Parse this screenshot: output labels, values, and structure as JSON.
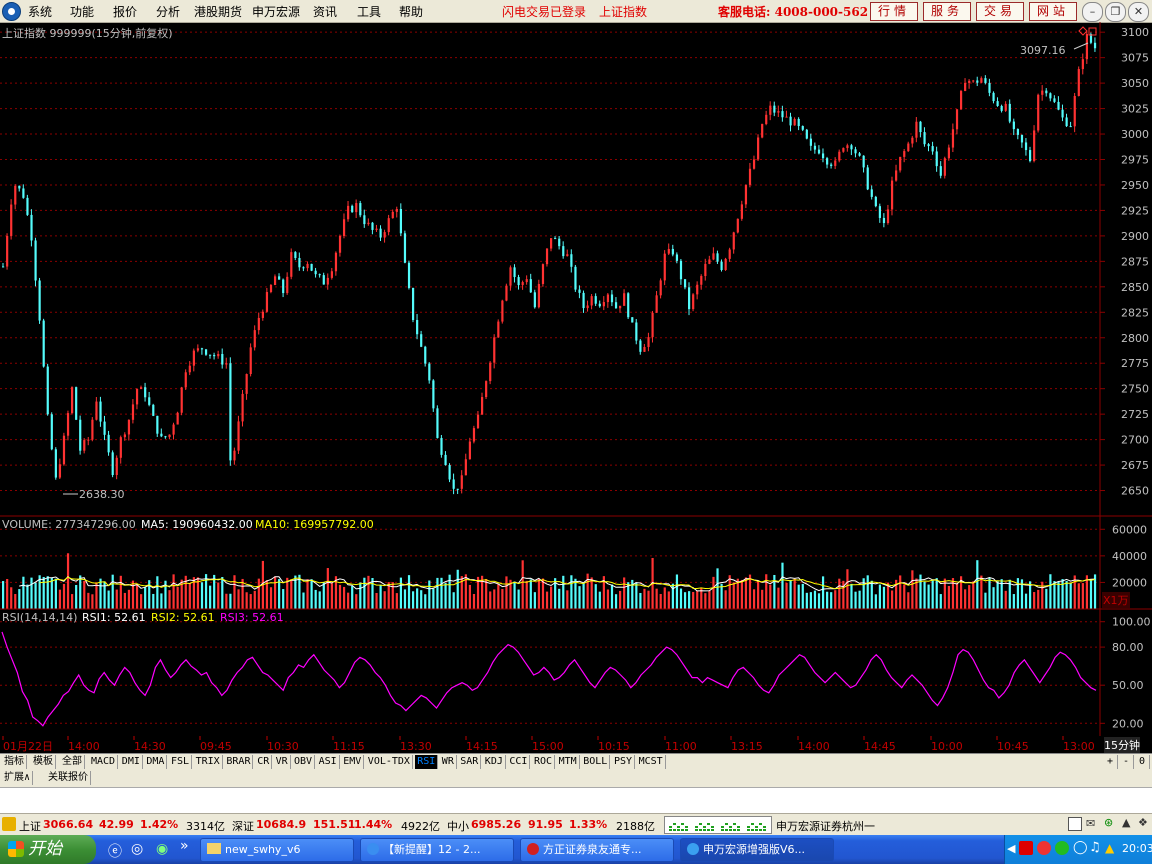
{
  "menu": {
    "items": [
      "系统",
      "功能",
      "报价",
      "分析",
      "港股期货",
      "申万宏源",
      "资讯",
      "工具",
      "帮助"
    ],
    "flash_login": "闪电交易已登录",
    "index_name": "上证指数",
    "hotline": "客服电话: 4008-000-562",
    "buttons": [
      "行情",
      "服务",
      "交易",
      "网站"
    ]
  },
  "chart_data": [
    {
      "type": "candlestick",
      "title": "上证指数 999999(15分钟,前复权)",
      "ylim": [
        2625,
        3110
      ],
      "yticks": [
        "3100",
        "3075",
        "3050",
        "3025",
        "3000",
        "2975",
        "2950",
        "2925",
        "2900",
        "2875",
        "2850",
        "2825",
        "2800",
        "2775",
        "2750",
        "2725",
        "2700",
        "2675",
        "2650"
      ],
      "annotations": [
        {
          "label": "3097.16"
        },
        {
          "label": "2638.30"
        }
      ],
      "close_path": [
        [
          0,
          2870
        ],
        [
          2,
          2935
        ],
        [
          3,
          2950
        ],
        [
          5,
          2940
        ],
        [
          7,
          2900
        ],
        [
          9,
          2820
        ],
        [
          11,
          2720
        ],
        [
          13,
          2660
        ],
        [
          15,
          2700
        ],
        [
          17,
          2750
        ],
        [
          19,
          2690
        ],
        [
          21,
          2700
        ],
        [
          23,
          2740
        ],
        [
          25,
          2700
        ],
        [
          27,
          2670
        ],
        [
          29,
          2700
        ],
        [
          31,
          2720
        ],
        [
          33,
          2750
        ],
        [
          35,
          2745
        ],
        [
          37,
          2720
        ],
        [
          39,
          2700
        ],
        [
          41,
          2705
        ],
        [
          43,
          2730
        ],
        [
          45,
          2770
        ],
        [
          47,
          2785
        ],
        [
          49,
          2790
        ],
        [
          51,
          2785
        ],
        [
          53,
          2780
        ],
        [
          55,
          2775
        ],
        [
          56,
          2680
        ],
        [
          57,
          2690
        ],
        [
          59,
          2740
        ],
        [
          61,
          2790
        ],
        [
          63,
          2820
        ],
        [
          65,
          2840
        ],
        [
          67,
          2860
        ],
        [
          69,
          2845
        ],
        [
          71,
          2880
        ],
        [
          73,
          2870
        ],
        [
          75,
          2875
        ],
        [
          77,
          2860
        ],
        [
          79,
          2855
        ],
        [
          81,
          2870
        ],
        [
          83,
          2900
        ],
        [
          85,
          2925
        ],
        [
          87,
          2930
        ],
        [
          89,
          2915
        ],
        [
          91,
          2905
        ],
        [
          93,
          2900
        ],
        [
          95,
          2915
        ],
        [
          97,
          2930
        ],
        [
          99,
          2870
        ],
        [
          101,
          2820
        ],
        [
          103,
          2790
        ],
        [
          105,
          2760
        ],
        [
          107,
          2700
        ],
        [
          109,
          2680
        ],
        [
          111,
          2650
        ],
        [
          113,
          2660
        ],
        [
          115,
          2700
        ],
        [
          117,
          2720
        ],
        [
          119,
          2760
        ],
        [
          121,
          2800
        ],
        [
          123,
          2840
        ],
        [
          125,
          2870
        ],
        [
          127,
          2850
        ],
        [
          129,
          2860
        ],
        [
          131,
          2830
        ],
        [
          133,
          2870
        ],
        [
          135,
          2900
        ],
        [
          137,
          2890
        ],
        [
          139,
          2880
        ],
        [
          141,
          2850
        ],
        [
          143,
          2830
        ],
        [
          145,
          2840
        ],
        [
          147,
          2835
        ],
        [
          149,
          2845
        ],
        [
          151,
          2830
        ],
        [
          153,
          2840
        ],
        [
          155,
          2810
        ],
        [
          157,
          2790
        ],
        [
          159,
          2800
        ],
        [
          161,
          2840
        ],
        [
          163,
          2880
        ],
        [
          165,
          2885
        ],
        [
          167,
          2860
        ],
        [
          169,
          2830
        ],
        [
          171,
          2850
        ],
        [
          173,
          2870
        ],
        [
          175,
          2880
        ],
        [
          177,
          2870
        ],
        [
          179,
          2890
        ],
        [
          181,
          2920
        ],
        [
          183,
          2950
        ],
        [
          185,
          2975
        ],
        [
          187,
          3010
        ],
        [
          189,
          3025
        ],
        [
          191,
          3020
        ],
        [
          193,
          3015
        ],
        [
          195,
          3010
        ],
        [
          197,
          3000
        ],
        [
          199,
          2985
        ],
        [
          201,
          2985
        ],
        [
          203,
          2975
        ],
        [
          205,
          2970
        ],
        [
          207,
          2990
        ],
        [
          209,
          2990
        ],
        [
          211,
          2975
        ],
        [
          213,
          2950
        ],
        [
          215,
          2925
        ],
        [
          217,
          2910
        ],
        [
          219,
          2950
        ],
        [
          221,
          2975
        ],
        [
          223,
          2990
        ],
        [
          225,
          3010
        ],
        [
          227,
          2990
        ],
        [
          229,
          2985
        ],
        [
          231,
          2960
        ],
        [
          233,
          2990
        ],
        [
          235,
          3020
        ],
        [
          237,
          3055
        ],
        [
          239,
          3050
        ],
        [
          241,
          3055
        ],
        [
          243,
          3040
        ],
        [
          245,
          3030
        ],
        [
          247,
          3025
        ],
        [
          249,
          3000
        ],
        [
          251,
          2990
        ],
        [
          253,
          2975
        ],
        [
          255,
          3040
        ],
        [
          257,
          3045
        ],
        [
          259,
          3030
        ],
        [
          261,
          3015
        ],
        [
          263,
          3010
        ],
        [
          265,
          3060
        ],
        [
          267,
          3095
        ],
        [
          269,
          3085
        ]
      ]
    },
    {
      "type": "bar",
      "title": "VOLUME: 277347296.00",
      "series": [
        {
          "name": "MA5: 190960432.00"
        },
        {
          "name": "MA10: 169957792.00"
        }
      ],
      "yticks": [
        "60000",
        "40000",
        "20000"
      ],
      "unit": "X1万",
      "ylim": [
        0,
        70000
      ],
      "base_volume": 22000
    },
    {
      "type": "line",
      "title": "RSI(14,14,14)",
      "series": [
        {
          "name": "RSI1: 52.61"
        },
        {
          "name": "RSI2: 52.61"
        },
        {
          "name": "RSI3: 52.61"
        }
      ],
      "yticks": [
        "100.00",
        "80.00",
        "50.00",
        "20.00"
      ],
      "ylim": [
        10,
        110
      ],
      "values": [
        92,
        80,
        70,
        60,
        45,
        38,
        25,
        22,
        18,
        25,
        30,
        35,
        42,
        45,
        52,
        58,
        50,
        46,
        44,
        55,
        60,
        54,
        50,
        58,
        64,
        60,
        52,
        46,
        42,
        50,
        64,
        70,
        62,
        56,
        60,
        66,
        70,
        65,
        62,
        58,
        60,
        52,
        48,
        42,
        46,
        54,
        60,
        64,
        70,
        72,
        66,
        60,
        58,
        54,
        50,
        46,
        56,
        60,
        66,
        64,
        70,
        74,
        68,
        62,
        58,
        54,
        48,
        52,
        60,
        68,
        72,
        70,
        66,
        60,
        56,
        50,
        42,
        36,
        34,
        30,
        34,
        38,
        42,
        40,
        36,
        32,
        38,
        44,
        48,
        50,
        52,
        50,
        46,
        48,
        54,
        60,
        68,
        74,
        78,
        82,
        80,
        76,
        70,
        64,
        58,
        60,
        64,
        60,
        54,
        56,
        60,
        66,
        70,
        64,
        58,
        52,
        48,
        54,
        60,
        64,
        62,
        58,
        54,
        48,
        52,
        58,
        62,
        66,
        72,
        76,
        80,
        78,
        74,
        68,
        62,
        56,
        56,
        52,
        56,
        54,
        52,
        50,
        48,
        56,
        62,
        64,
        60,
        56,
        50,
        46,
        44,
        50,
        58,
        62,
        66,
        70,
        74,
        72,
        66,
        60,
        56,
        52,
        56,
        60,
        56,
        52,
        48,
        50,
        56,
        62,
        70,
        74,
        70,
        62,
        56,
        52,
        48,
        54,
        58,
        54,
        50,
        44,
        38,
        34,
        40,
        48,
        60,
        74,
        78,
        76,
        70,
        62,
        54,
        48,
        46,
        40,
        44,
        50,
        60,
        66,
        70,
        64,
        58,
        52,
        58,
        64,
        72,
        76,
        74,
        70,
        64,
        56,
        52,
        48,
        46
      ]
    }
  ],
  "time_axis": [
    "01月22日",
    "14:00",
    "14:30",
    "09:45",
    "10:30",
    "11:15",
    "13:30",
    "14:15",
    "15:00",
    "10:15",
    "11:00",
    "13:15",
    "14:00",
    "14:45",
    "10:00",
    "10:45",
    "13:00"
  ],
  "period_label": "15分钟",
  "indicator_tabs": [
    "指标",
    "模板",
    "全部",
    "MACD",
    "DMI",
    "DMA",
    "FSL",
    "TRIX",
    "BRAR",
    "CR",
    "VR",
    "OBV",
    "ASI",
    "EMV",
    "VOL-TDX",
    "RSI",
    "WR",
    "SAR",
    "KDJ",
    "CCI",
    "ROC",
    "MTM",
    "BOLL",
    "PSY",
    "MCST"
  ],
  "active_tab": "RSI",
  "zoom_buttons": [
    "+",
    "-",
    "0"
  ],
  "sub_tabs": [
    "扩展∧",
    "关联报价"
  ],
  "status": {
    "sh_name": "上证",
    "sh_val": "3066.64",
    "sh_chg": "42.99",
    "sh_pct": "1.42%",
    "sh_amt": "3314亿",
    "sz_name": "深证",
    "sz_val": "10684.9",
    "sz_chg": "151.51",
    "sz_pct": "1.44%",
    "sz_amt": "4922亿",
    "zx_name": "中小",
    "zx_val": "6985.26",
    "zx_chg": "91.95",
    "zx_pct": "1.33%",
    "zx_amt": "2188亿",
    "broker": "申万宏源证券杭州一"
  },
  "taskbar": {
    "start": "开始",
    "tasks": [
      "new_swhy_v6",
      "【新提醒】12 - 2...",
      "方正证券泉友通专...",
      "申万宏源增强版V6..."
    ],
    "clock": "20:03"
  },
  "colors": {
    "up": "#ff3232",
    "down": "#54fcfc",
    "rsi": "#ff00ff",
    "ma5": "#ffffff",
    "ma10": "#ffff00",
    "grid": "#8b0000"
  }
}
